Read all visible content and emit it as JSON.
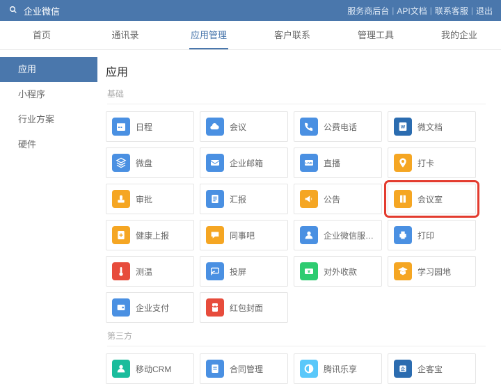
{
  "brand": "企业微信",
  "toplinks": [
    "服务商后台",
    "API文档",
    "联系客服",
    "退出"
  ],
  "nav": [
    {
      "label": "首页"
    },
    {
      "label": "通讯录"
    },
    {
      "label": "应用管理",
      "active": true
    },
    {
      "label": "客户联系"
    },
    {
      "label": "管理工具"
    },
    {
      "label": "我的企业"
    }
  ],
  "sidebar": [
    {
      "label": "应用",
      "active": true
    },
    {
      "label": "小程序"
    },
    {
      "label": "行业方案"
    },
    {
      "label": "硬件"
    }
  ],
  "page_title": "应用",
  "sections": [
    {
      "label": "基础",
      "apps": [
        {
          "name": "日程",
          "icon": "calendar",
          "color": "c-blue"
        },
        {
          "name": "会议",
          "icon": "cloud",
          "color": "c-blue"
        },
        {
          "name": "公费电话",
          "icon": "phone",
          "color": "c-blue"
        },
        {
          "name": "微文档",
          "icon": "doc-w",
          "color": "c-dblue"
        },
        {
          "name": "微盘",
          "icon": "disk",
          "color": "c-blue"
        },
        {
          "name": "企业邮箱",
          "icon": "mail",
          "color": "c-blue"
        },
        {
          "name": "直播",
          "icon": "live",
          "color": "c-blue"
        },
        {
          "name": "打卡",
          "icon": "pin",
          "color": "c-orange"
        },
        {
          "name": "审批",
          "icon": "stamp",
          "color": "c-orange"
        },
        {
          "name": "汇报",
          "icon": "report",
          "color": "c-blue"
        },
        {
          "name": "公告",
          "icon": "announce",
          "color": "c-orange"
        },
        {
          "name": "会议室",
          "icon": "door",
          "color": "c-orange",
          "highlight": true
        },
        {
          "name": "健康上报",
          "icon": "health",
          "color": "c-orange"
        },
        {
          "name": "同事吧",
          "icon": "chat",
          "color": "c-orange"
        },
        {
          "name": "企业微信服务商助手",
          "icon": "assistant",
          "color": "c-blue"
        },
        {
          "name": "打印",
          "icon": "print",
          "color": "c-blue"
        },
        {
          "name": "测温",
          "icon": "thermo",
          "color": "c-red"
        },
        {
          "name": "投屏",
          "icon": "cast",
          "color": "c-blue"
        },
        {
          "name": "对外收款",
          "icon": "pay",
          "color": "c-green"
        },
        {
          "name": "学习园地",
          "icon": "learn",
          "color": "c-orange"
        },
        {
          "name": "企业支付",
          "icon": "wallet",
          "color": "c-blue"
        },
        {
          "name": "红包封面",
          "icon": "redpacket",
          "color": "c-red"
        }
      ]
    },
    {
      "label": "第三方",
      "apps": [
        {
          "name": "移动CRM",
          "icon": "crm",
          "color": "c-teal"
        },
        {
          "name": "合同管理",
          "icon": "contract",
          "color": "c-blue"
        },
        {
          "name": "腾讯乐享",
          "icon": "lexiang",
          "color": "c-lblue"
        },
        {
          "name": "企客宝",
          "icon": "qkb",
          "color": "c-dblue"
        }
      ]
    }
  ]
}
